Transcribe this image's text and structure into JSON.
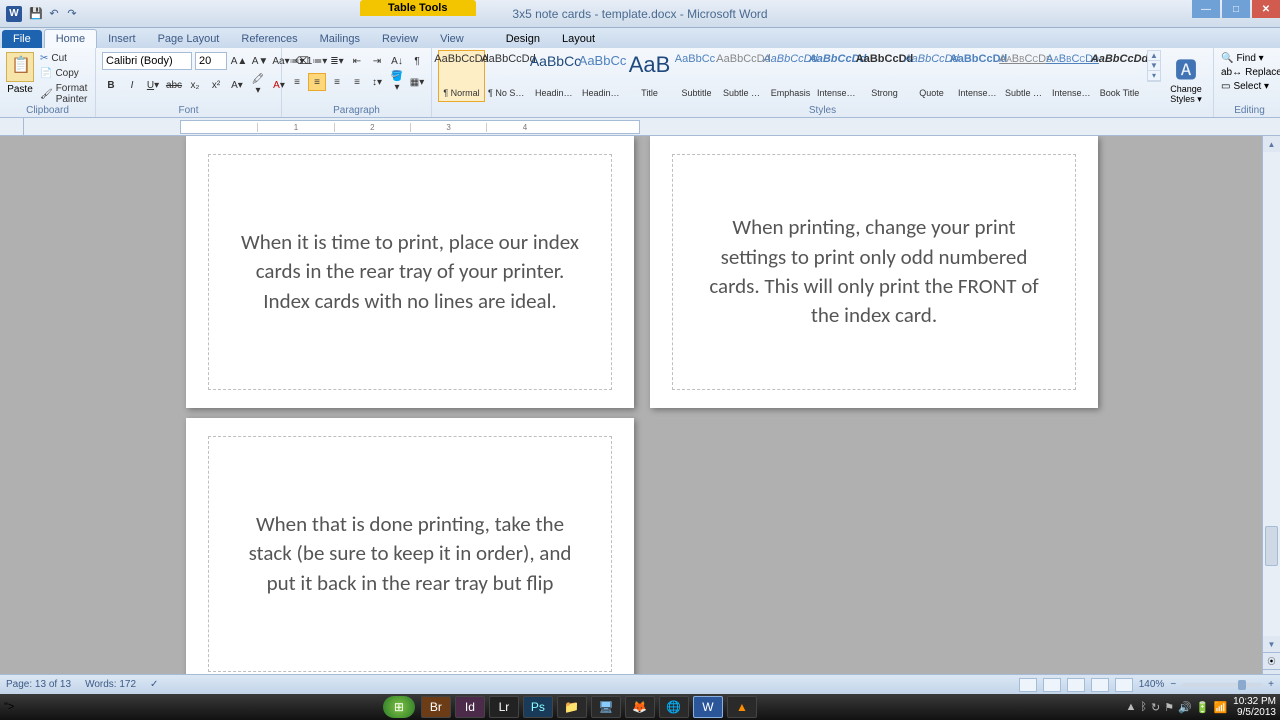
{
  "title_app": "Microsoft Word",
  "doc_title": "3x5 note cards - template.docx - Microsoft Word",
  "table_tools": "Table Tools",
  "tabs": {
    "file": "File",
    "home": "Home",
    "insert": "Insert",
    "page_layout": "Page Layout",
    "references": "References",
    "mailings": "Mailings",
    "review": "Review",
    "view": "View",
    "design": "Design",
    "layout": "Layout"
  },
  "clipboard": {
    "paste": "Paste",
    "cut": "Cut",
    "copy": "Copy",
    "painter": "Format Painter",
    "label": "Clipboard"
  },
  "font": {
    "name": "Calibri (Body)",
    "size": "20",
    "label": "Font"
  },
  "paragraph": {
    "label": "Paragraph"
  },
  "styles": {
    "label": "Styles",
    "change": "Change Styles ▾",
    "items": [
      {
        "preview": "AaBbCcDd",
        "name": "¶ Normal",
        "sel": true,
        "cls": ""
      },
      {
        "preview": "AaBbCcDd",
        "name": "¶ No Spaci...",
        "sel": false,
        "cls": ""
      },
      {
        "preview": "AaBbCc",
        "name": "Heading 1",
        "sel": false,
        "cls": "h1"
      },
      {
        "preview": "AaBbCc",
        "name": "Heading 2",
        "sel": false,
        "cls": "h2"
      },
      {
        "preview": "AaB",
        "name": "Title",
        "sel": false,
        "cls": "ttl"
      },
      {
        "preview": "AaBbCc.",
        "name": "Subtitle",
        "sel": false,
        "cls": "sub"
      },
      {
        "preview": "AaBbCcDd",
        "name": "Subtle Em...",
        "sel": false,
        "cls": "se"
      },
      {
        "preview": "AaBbCcDd",
        "name": "Emphasis",
        "sel": false,
        "cls": "em"
      },
      {
        "preview": "AaBbCcDd",
        "name": "Intense E...",
        "sel": false,
        "cls": "ie"
      },
      {
        "preview": "AaBbCcDd",
        "name": "Strong",
        "sel": false,
        "cls": "st"
      },
      {
        "preview": "AaBbCcDd",
        "name": "Quote",
        "sel": false,
        "cls": "qt"
      },
      {
        "preview": "AaBbCcDd",
        "name": "Intense Q...",
        "sel": false,
        "cls": "iq"
      },
      {
        "preview": "AaBbCcDd",
        "name": "Subtle Ref...",
        "sel": false,
        "cls": "sr"
      },
      {
        "preview": "AaBbCcDd",
        "name": "Intense R...",
        "sel": false,
        "cls": "ir"
      },
      {
        "preview": "AaBbCcDd",
        "name": "Book Title",
        "sel": false,
        "cls": "bt"
      }
    ]
  },
  "editing": {
    "find": "Find ▾",
    "replace": "Replace",
    "select": "Select ▾",
    "label": "Editing"
  },
  "cards": [
    "When it is time to print, place our index cards in the rear tray of your printer.  Index cards with no lines are ideal.",
    "When printing, change your print settings to print only odd numbered cards.  This will only print the FRONT of the index card.",
    "When that is done printing, take the stack (be sure to keep it in order), and put it back in the rear tray but flip"
  ],
  "status": {
    "page": "Page: 13 of 13",
    "words": "Words: 172",
    "zoom": "140%"
  },
  "tray": {
    "time": "10:32 PM",
    "date": "9/5/2013"
  }
}
